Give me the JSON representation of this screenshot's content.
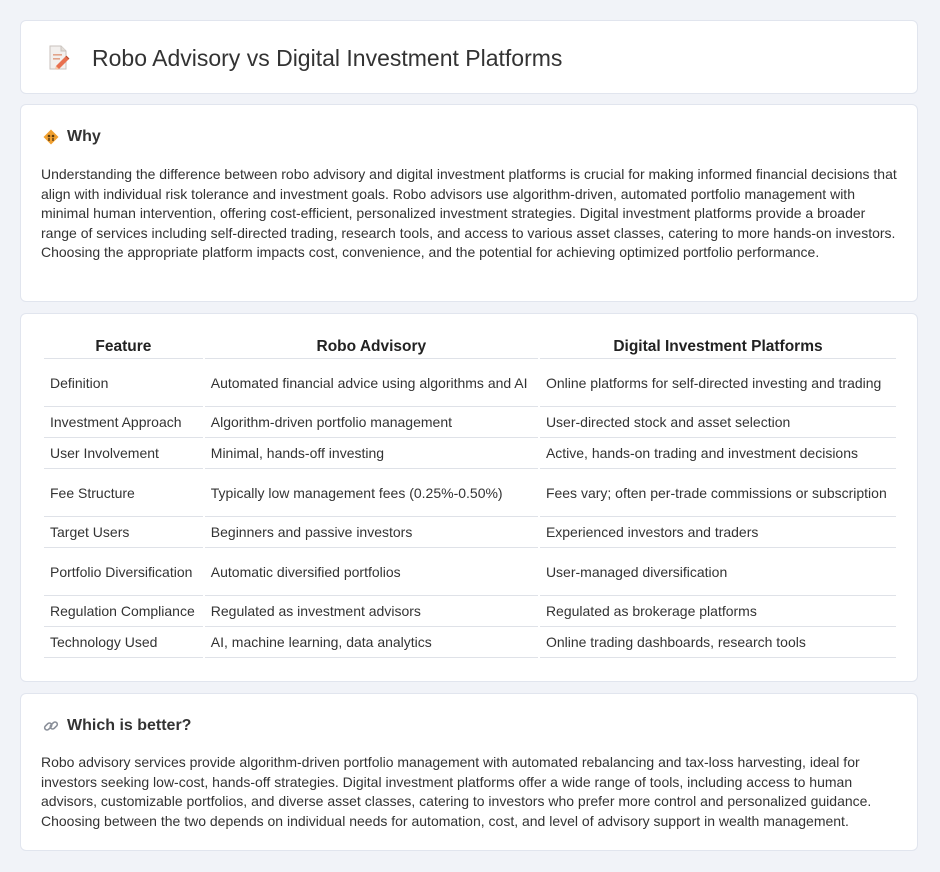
{
  "header": {
    "title": "Robo Advisory vs Digital Investment Platforms",
    "icon": "document-pencil-icon"
  },
  "why": {
    "icon": "diamond-sign-icon",
    "heading": "Why",
    "body": "Understanding the difference between robo advisory and digital investment platforms is crucial for making informed financial decisions that align with individual risk tolerance and investment goals. Robo advisors use algorithm-driven, automated portfolio management with minimal human intervention, offering cost-efficient, personalized investment strategies. Digital investment platforms provide a broader range of services including self-directed trading, research tools, and access to various asset classes, catering to more hands-on investors. Choosing the appropriate platform impacts cost, convenience, and the potential for achieving optimized portfolio performance."
  },
  "comparison": {
    "headers": [
      "Feature",
      "Robo Advisory",
      "Digital Investment Platforms"
    ],
    "rows": [
      [
        "Definition",
        "Automated financial advice using algorithms and AI",
        "Online platforms for self-directed investing and trading"
      ],
      [
        "Investment Approach",
        "Algorithm-driven portfolio management",
        "User-directed stock and asset selection"
      ],
      [
        "User Involvement",
        "Minimal, hands-off investing",
        "Active, hands-on trading and investment decisions"
      ],
      [
        "Fee Structure",
        "Typically low management fees (0.25%-0.50%)",
        "Fees vary; often per-trade commissions or subscription"
      ],
      [
        "Target Users",
        "Beginners and passive investors",
        "Experienced investors and traders"
      ],
      [
        "Portfolio Diversification",
        "Automatic diversified portfolios",
        "User-managed diversification"
      ],
      [
        "Regulation Compliance",
        "Regulated as investment advisors",
        "Regulated as brokerage platforms"
      ],
      [
        "Technology Used",
        "AI, machine learning, data analytics",
        "Online trading dashboards, research tools"
      ]
    ]
  },
  "better": {
    "icon": "link-icon",
    "heading": "Which is better?",
    "body": "Robo advisory services provide algorithm-driven portfolio management with automated rebalancing and tax-loss harvesting, ideal for investors seeking low-cost, hands-off strategies. Digital investment platforms offer a wide range of tools, including access to human advisors, customizable portfolios, and diverse asset classes, catering to investors who prefer more control and personalized guidance. Choosing between the two depends on individual needs for automation, cost, and level of advisory support in wealth management."
  },
  "colors": {
    "page_background": "#f1f3f8",
    "card_background": "#ffffff",
    "icon_accent": "#f0a030"
  }
}
